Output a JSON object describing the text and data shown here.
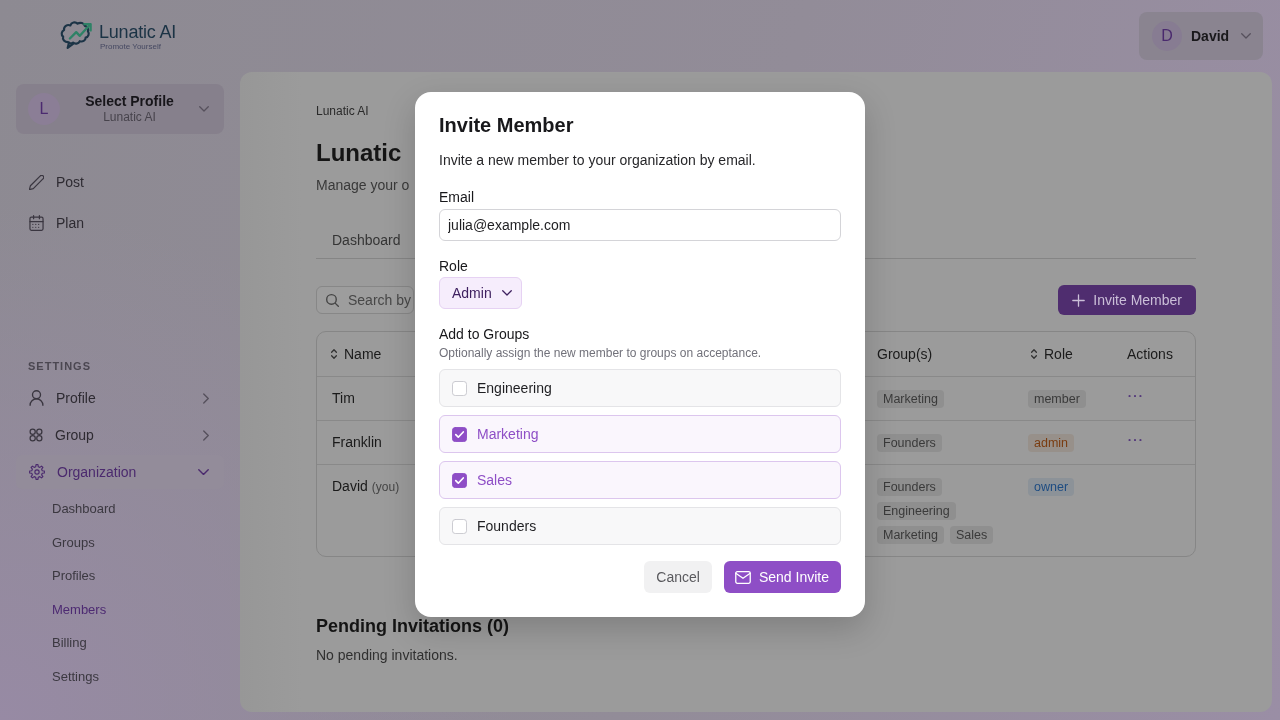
{
  "header": {
    "logo": {
      "name": "Lunatic AI",
      "tagline": "Promote Yourself"
    },
    "user_menu": {
      "initial": "D",
      "name": "David"
    }
  },
  "sidebar": {
    "profile_select": {
      "initial": "L",
      "title": "Select Profile",
      "subtitle": "Lunatic AI"
    },
    "nav": [
      {
        "label": "Post",
        "selected": false
      },
      {
        "label": "Plan",
        "selected": false
      }
    ],
    "section_title": "SETTINGS",
    "settings_items": [
      {
        "label": "Profile",
        "expanded": false,
        "selected": false
      },
      {
        "label": "Group",
        "expanded": false,
        "selected": false
      },
      {
        "label": "Organization",
        "expanded": true,
        "selected": true,
        "children": [
          {
            "label": "Dashboard",
            "selected": false
          },
          {
            "label": "Groups",
            "selected": false
          },
          {
            "label": "Profiles",
            "selected": false
          },
          {
            "label": "Members",
            "selected": true
          },
          {
            "label": "Billing",
            "selected": false
          },
          {
            "label": "Settings",
            "selected": false
          }
        ]
      }
    ]
  },
  "main": {
    "breadcrumb": "Lunatic AI",
    "title": "Lunatic",
    "subtitle": "Manage your o",
    "tabs": [
      {
        "label": "Dashboard",
        "selected": false
      }
    ],
    "search": {
      "placeholder": "Search by"
    },
    "invite_button": "Invite Member",
    "table": {
      "columns": [
        {
          "label": "Name",
          "sortable": true
        },
        {
          "label": "Group(s)",
          "sortable": false
        },
        {
          "label": "Role",
          "sortable": true
        },
        {
          "label": "Actions",
          "sortable": false
        }
      ],
      "rows": [
        {
          "name": "Tim",
          "groups": [
            "Marketing"
          ],
          "role": {
            "label": "member",
            "color": "#3a3a3a"
          },
          "actions_menu": true
        },
        {
          "name": "Franklin",
          "groups": [
            "Founders"
          ],
          "role": {
            "label": "admin",
            "color": "#7a3c10"
          },
          "actions_menu": true
        },
        {
          "name": "David",
          "you_label": "(you)",
          "groups": [
            "Founders",
            "Engineering",
            "Marketing",
            "Sales"
          ],
          "role": {
            "label": "owner",
            "color": "#1d4c82"
          },
          "actions_menu": false
        }
      ]
    },
    "pending": {
      "title": "Pending Invitations (0)",
      "empty_text": "No pending invitations."
    }
  },
  "dialog": {
    "title": "Invite Member",
    "description": "Invite a new member to your organization by email.",
    "email": {
      "label": "Email",
      "value": "julia@example.com"
    },
    "role": {
      "label": "Role",
      "value": "Admin"
    },
    "groups": {
      "label": "Add to Groups",
      "hint": "Optionally assign the new member to groups on acceptance.",
      "options": [
        {
          "label": "Engineering",
          "checked": false
        },
        {
          "label": "Marketing",
          "checked": true
        },
        {
          "label": "Sales",
          "checked": true
        },
        {
          "label": "Founders",
          "checked": false
        }
      ]
    },
    "buttons": [
      {
        "label": "Cancel",
        "kind": "secondary"
      },
      {
        "label": "Send Invite",
        "kind": "primary"
      }
    ]
  }
}
